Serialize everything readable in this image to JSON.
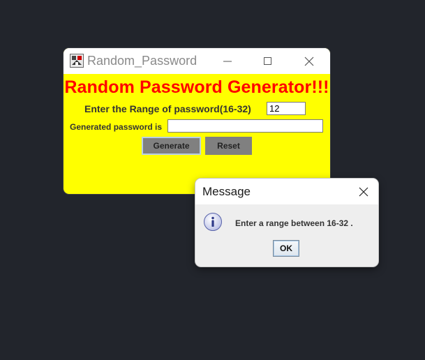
{
  "main_window": {
    "title": "Random_Password",
    "heading": "Random Password Generator!!!",
    "range_label": "Enter the Range of password(16-32)",
    "range_value": "12",
    "generated_label": "Generated password is",
    "generated_value": "",
    "generate_button": "Generate",
    "reset_button": "Reset",
    "icons": [
      "app-icon",
      "minimize-icon",
      "maximize-icon",
      "close-icon"
    ]
  },
  "message_dialog": {
    "title": "Message",
    "message": "Enter a range between 16-32 .",
    "ok_button": "OK",
    "icons": [
      "information-icon",
      "close-icon"
    ]
  },
  "colors": {
    "desktop_background": "#22252c",
    "window_background": "#ffff00",
    "heading_text": "#ff0000",
    "button_gray": "#808080",
    "dialog_background": "#eeeeee"
  }
}
